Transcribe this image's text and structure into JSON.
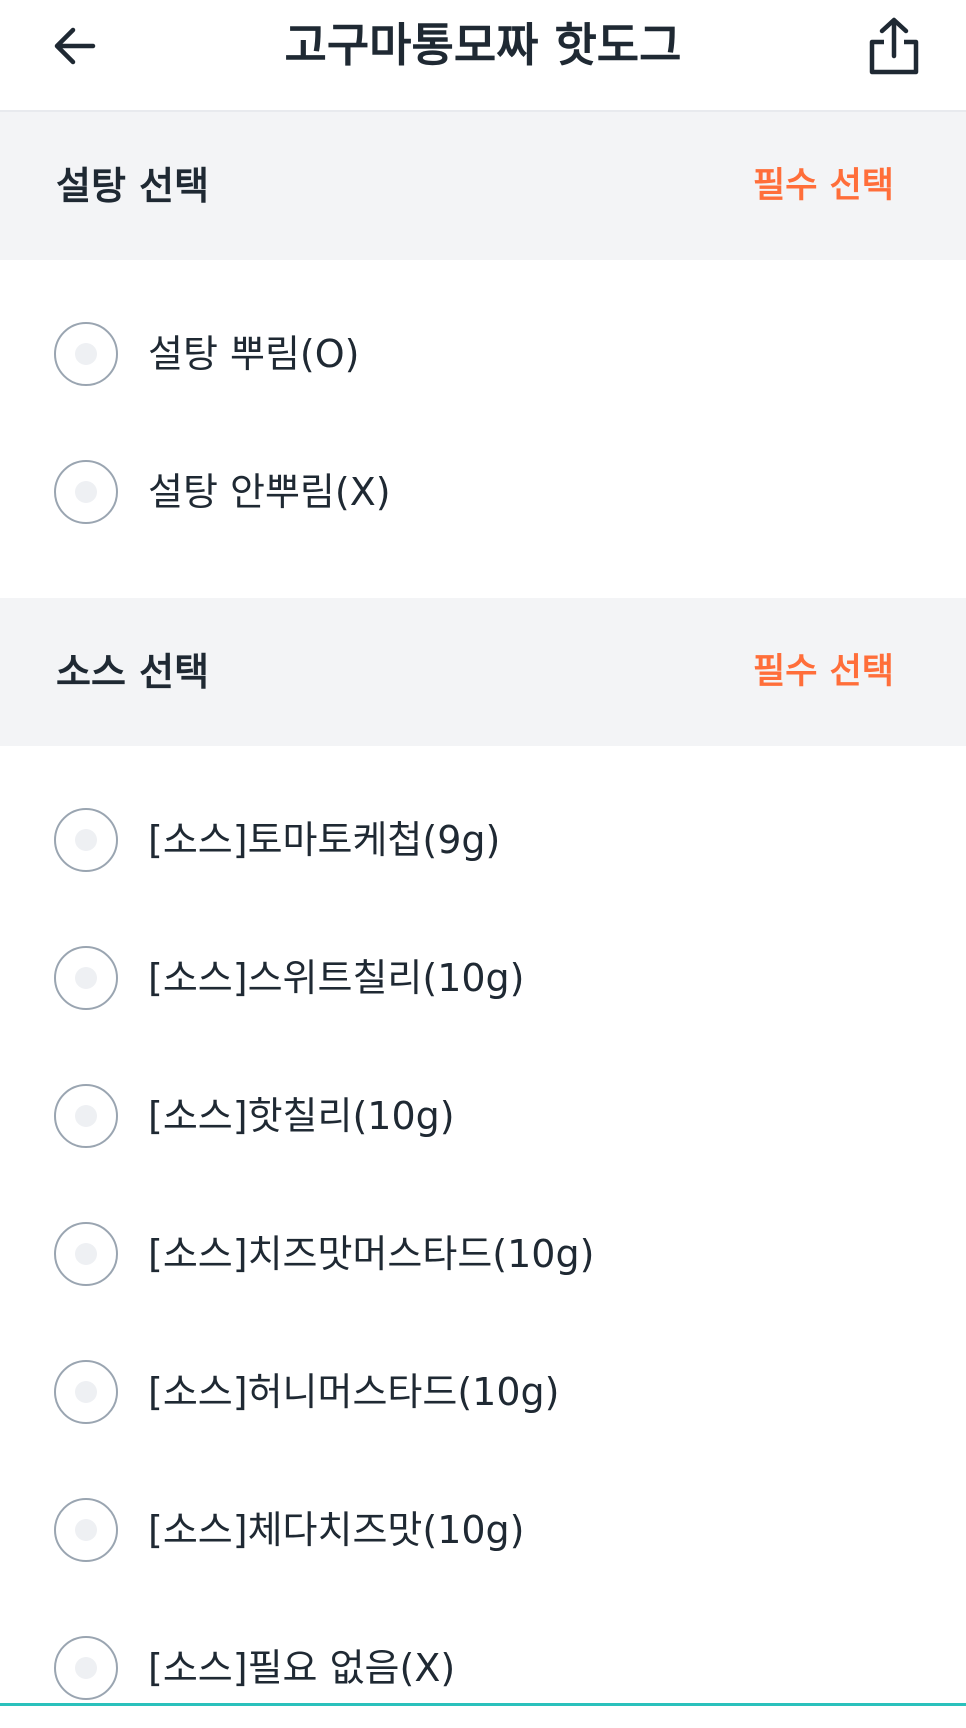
{
  "header": {
    "title": "고구마통모짜 핫도그",
    "back_icon": "arrow-left-icon",
    "share_icon": "share-icon"
  },
  "sections": [
    {
      "title": "설탕 선택",
      "badge": "필수 선택",
      "options": [
        {
          "label": "설탕 뿌림(O)"
        },
        {
          "label": "설탕 안뿌림(X)"
        }
      ]
    },
    {
      "title": "소스 선택",
      "badge": "필수 선택",
      "options": [
        {
          "label": "[소스]토마토케첩(9g)"
        },
        {
          "label": "[소스]스위트칠리(10g)"
        },
        {
          "label": "[소스]핫칠리(10g)"
        },
        {
          "label": "[소스]치즈맛머스타드(10g)"
        },
        {
          "label": "[소스]허니머스타드(10g)"
        },
        {
          "label": "[소스]체다치즈맛(10g)"
        },
        {
          "label": "[소스]필요 없음(X)"
        }
      ]
    }
  ],
  "colors": {
    "accent": "#ff6e3a",
    "text": "#1f2933",
    "section_bg": "#f3f4f6",
    "radio_border": "#9aa5b1",
    "bottom_accent": "#2ac1bc"
  }
}
